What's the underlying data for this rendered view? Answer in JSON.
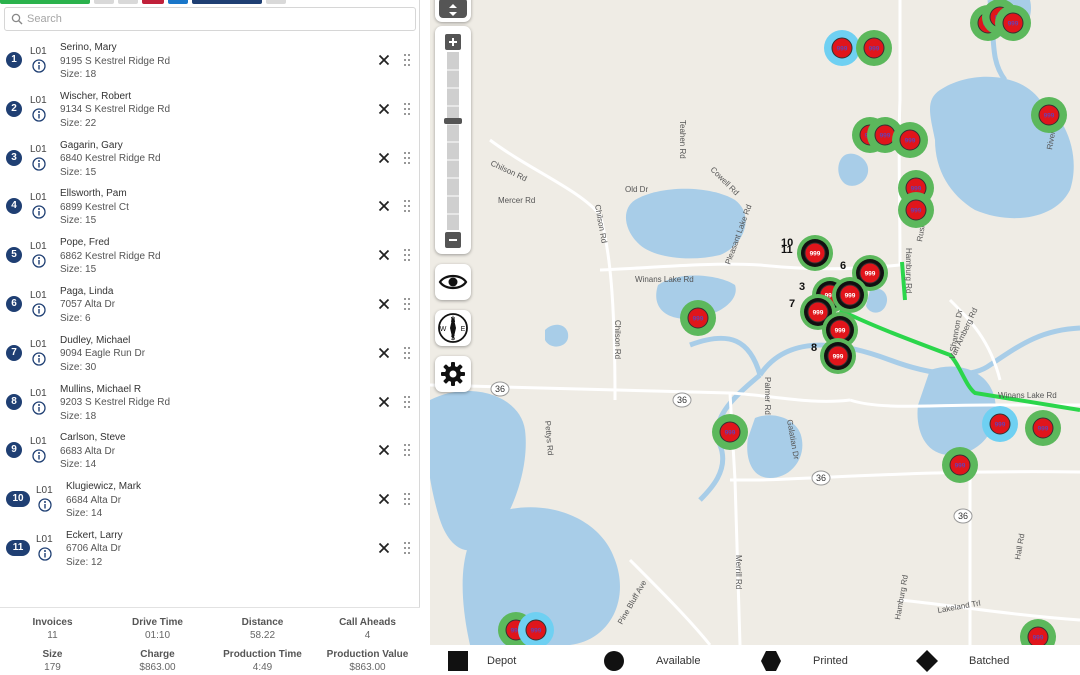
{
  "colors": {
    "route_badge": "#1f3f73",
    "route_line": "#2bd64b",
    "marker_ring": "#5cb85c",
    "marker_fill": "#e0151b",
    "marker_available_ring": "#6fd0f2",
    "water": "#a8cde8",
    "land": "#efece5",
    "road": "#ffffff",
    "tab_colors": [
      "#2bb24c",
      "#d9d9d9",
      "#d9d9d9",
      "#c0203a",
      "#1976c9",
      "#1f3f73",
      "#d9d9d9"
    ]
  },
  "search": {
    "placeholder": "Search",
    "icon": "search-icon"
  },
  "stops": [
    {
      "num": "1",
      "route": "L01",
      "name": "Serino, Mary",
      "address": "9195 S Kestrel Ridge Rd",
      "size": "Size: 18"
    },
    {
      "num": "2",
      "route": "L01",
      "name": "Wischer, Robert",
      "address": "9134 S Kestrel Ridge Rd",
      "size": "Size: 22"
    },
    {
      "num": "3",
      "route": "L01",
      "name": "Gagarin, Gary",
      "address": "6840 Kestrel Ridge Rd",
      "size": "Size: 15"
    },
    {
      "num": "4",
      "route": "L01",
      "name": "Ellsworth, Pam",
      "address": "6899 Kestrel Ct",
      "size": "Size: 15"
    },
    {
      "num": "5",
      "route": "L01",
      "name": "Pope, Fred",
      "address": "6862 Kestrel Ridge Rd",
      "size": "Size: 15"
    },
    {
      "num": "6",
      "route": "L01",
      "name": "Paga, Linda",
      "address": "7057 Alta Dr",
      "size": "Size: 6"
    },
    {
      "num": "7",
      "route": "L01",
      "name": "Dudley, Michael",
      "address": "9094 Eagle Run Dr",
      "size": "Size: 30"
    },
    {
      "num": "8",
      "route": "L01",
      "name": "Mullins, Michael R",
      "address": "9203 S Kestrel Ridge Rd",
      "size": "Size: 18"
    },
    {
      "num": "9",
      "route": "L01",
      "name": "Carlson, Steve",
      "address": "6683 Alta Dr",
      "size": "Size: 14"
    },
    {
      "num": "10",
      "route": "L01",
      "name": "Klugiewicz, Mark",
      "address": "6684 Alta Dr",
      "size": "Size: 14"
    },
    {
      "num": "11",
      "route": "L01",
      "name": "Eckert, Larry",
      "address": "6706 Alta Dr",
      "size": "Size: 12"
    }
  ],
  "summary": [
    {
      "label": "Invoices",
      "value": "11"
    },
    {
      "label": "Drive Time",
      "value": "01:10"
    },
    {
      "label": "Distance",
      "value": "58.22"
    },
    {
      "label": "Call Aheads",
      "value": "4"
    },
    {
      "label": "Size",
      "value": "179"
    },
    {
      "label": "Charge",
      "value": "$863.00"
    },
    {
      "label": "Production Time",
      "value": "4:49"
    },
    {
      "label": "Production Value",
      "value": "$863.00"
    }
  ],
  "map": {
    "road_labels": [
      {
        "text": "Chilson Rd",
        "key": "chilson_rd_nw"
      },
      {
        "text": "Mercer Rd",
        "key": "mercer_rd"
      },
      {
        "text": "Old Dr",
        "key": "old_dr"
      },
      {
        "text": "Cowell Rd",
        "key": "cowell_rd"
      },
      {
        "text": "Teahen Rd",
        "key": "teahen_rd"
      },
      {
        "text": "Pleasant Lake Rd",
        "key": "pleasant_lake_rd"
      },
      {
        "text": "Chilson Rd",
        "key": "chilson_rd_n"
      },
      {
        "text": "Winans Lake Rd",
        "key": "winans_lake_rd"
      },
      {
        "text": "Chilson Rd",
        "key": "chilson_rd_s"
      },
      {
        "text": "Palmer Rd",
        "key": "palmer_rd"
      },
      {
        "text": "Galatian Dr",
        "key": "galatian_dr"
      },
      {
        "text": "Pettys Rd",
        "key": "pettys_rd"
      },
      {
        "text": "Merrill Rd",
        "key": "merrill_rd"
      },
      {
        "text": "Pine Bluff Ave",
        "key": "pine_bluff_ave"
      },
      {
        "text": "Van Amberg Rd",
        "key": "van_amberg_rd"
      },
      {
        "text": "Shannon Dr",
        "key": "shannon_dr"
      },
      {
        "text": "Winans Lake Rd",
        "key": "winans_lake_rd_e"
      },
      {
        "text": "Lakeland Trl",
        "key": "lakeland_trl"
      },
      {
        "text": "Hall Rd",
        "key": "hall_rd"
      },
      {
        "text": "Rushton Rd",
        "key": "rushton_rd"
      },
      {
        "text": "Riverside Rd",
        "key": "riverside_rd"
      },
      {
        "text": "Hamburg Rd",
        "key": "hamburg_rd"
      },
      {
        "text": "Hamburg Rd",
        "key": "hamburg_rd_s"
      }
    ],
    "highway_shield": "36",
    "marker_text": "999",
    "stop_labels": [
      "10",
      "11",
      "3",
      "6",
      "7",
      "8"
    ]
  },
  "legend": [
    {
      "shape": "square",
      "label": "Depot"
    },
    {
      "shape": "circle",
      "label": "Available"
    },
    {
      "shape": "hexagon",
      "label": "Printed"
    },
    {
      "shape": "diamond",
      "label": "Batched"
    }
  ]
}
